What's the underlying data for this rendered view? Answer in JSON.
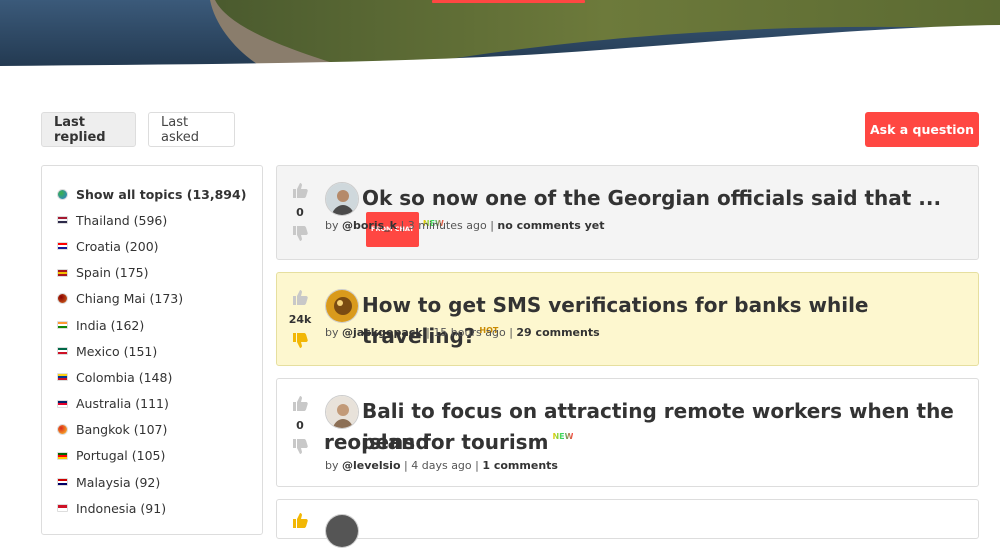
{
  "tabs": {
    "last_replied": "Last replied",
    "last_asked": "Last asked"
  },
  "ask_button": "Ask a question",
  "topics": [
    {
      "label": "Show all topics (13,894)",
      "flag": "globe-icon",
      "colors": [
        "#2c7cd6",
        "#3bb24a"
      ]
    },
    {
      "label": "Thailand (596)",
      "flag": "thailand-flag",
      "colors": [
        "#a51931",
        "#f4f5f8",
        "#2d2a4a"
      ]
    },
    {
      "label": "Croatia (200)",
      "flag": "croatia-flag",
      "colors": [
        "#ff0000",
        "#ffffff",
        "#171796"
      ]
    },
    {
      "label": "Spain (175)",
      "flag": "spain-flag",
      "colors": [
        "#aa151b",
        "#f1bf00",
        "#aa151b"
      ]
    },
    {
      "label": "Chiang Mai (173)",
      "flag": "chiang-mai-icon",
      "colors": [
        "#d2691e",
        "#8b0000"
      ]
    },
    {
      "label": "India (162)",
      "flag": "india-flag",
      "colors": [
        "#ff9933",
        "#ffffff",
        "#138808"
      ]
    },
    {
      "label": "Mexico (151)",
      "flag": "mexico-flag",
      "colors": [
        "#006847",
        "#ffffff",
        "#ce1126"
      ]
    },
    {
      "label": "Colombia (148)",
      "flag": "colombia-flag",
      "colors": [
        "#fcd116",
        "#003893",
        "#ce1126"
      ]
    },
    {
      "label": "Australia (111)",
      "flag": "australia-flag",
      "colors": [
        "#012169",
        "#e4002b",
        "#ffffff"
      ]
    },
    {
      "label": "Bangkok (107)",
      "flag": "bangkok-icon",
      "colors": [
        "#ffc72c",
        "#da291c"
      ]
    },
    {
      "label": "Portugal (105)",
      "flag": "portugal-flag",
      "colors": [
        "#006600",
        "#ff0000",
        "#ffcc00"
      ]
    },
    {
      "label": "Malaysia (92)",
      "flag": "malaysia-flag",
      "colors": [
        "#cc0001",
        "#ffffff",
        "#010066"
      ]
    },
    {
      "label": "Indonesia (91)",
      "flag": "indonesia-flag",
      "colors": [
        "#ce1126",
        "#ffffff"
      ]
    }
  ],
  "posts": [
    {
      "title": "Ok so now one of the Georgian officials said that ...",
      "badge": "FROM CHAT",
      "tag": "NEW",
      "votes": "0",
      "author": "@boris_k",
      "time": "3 minutes ago",
      "comments": "no comments yet"
    },
    {
      "title": "How to get SMS verifications for banks while traveling?",
      "tag": "HOT",
      "votes": "24k",
      "author": "@jackgopack",
      "time": "15 hours ago",
      "comments": "29 comments"
    },
    {
      "title_line1": "Bali to focus on attracting remote workers when the island",
      "title_line2": "reopens for tourism",
      "tag": "NEW",
      "votes": "0",
      "author": "@levelsio",
      "time": "4 days ago",
      "comments": "1 comments"
    }
  ],
  "meta": {
    "by": "by",
    "sep": "|"
  },
  "colors": {
    "accent": "#ff4742",
    "hot_bg": "#fdf7cf",
    "card_bg": "#f4f4f4"
  }
}
